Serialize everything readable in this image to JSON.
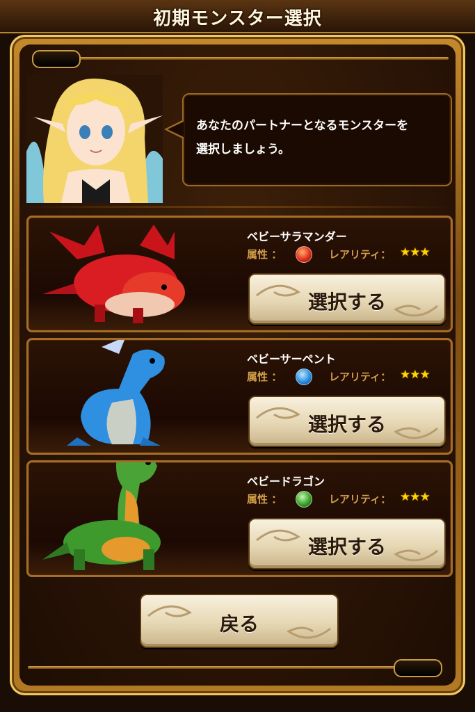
{
  "header": {
    "title": "初期モンスター選択"
  },
  "dialog": {
    "message_line1": "あなたのパートナーとなるモンスターを",
    "message_line2": "選択しましょう。"
  },
  "labels": {
    "attribute": "属性 ：",
    "rarity": "レアリティ：",
    "select": "選択する",
    "back": "戻る"
  },
  "monsters": [
    {
      "name": "ベビーサラマンダー",
      "element_icon": "fire-orb-icon",
      "element_color": "#e0301a",
      "rarity": "★★★",
      "rarity_stars": 3
    },
    {
      "name": "ベビーサーペント",
      "element_icon": "water-orb-icon",
      "element_color": "#2a8fe0",
      "rarity": "★★★",
      "rarity_stars": 3
    },
    {
      "name": "ベビードラゴン",
      "element_icon": "wood-orb-icon",
      "element_color": "#3aa32c",
      "rarity": "★★★",
      "rarity_stars": 3
    }
  ],
  "colors": {
    "frame_gold": "#c48a2c",
    "panel_dark": "#1c0903",
    "star": "#ffd400"
  }
}
